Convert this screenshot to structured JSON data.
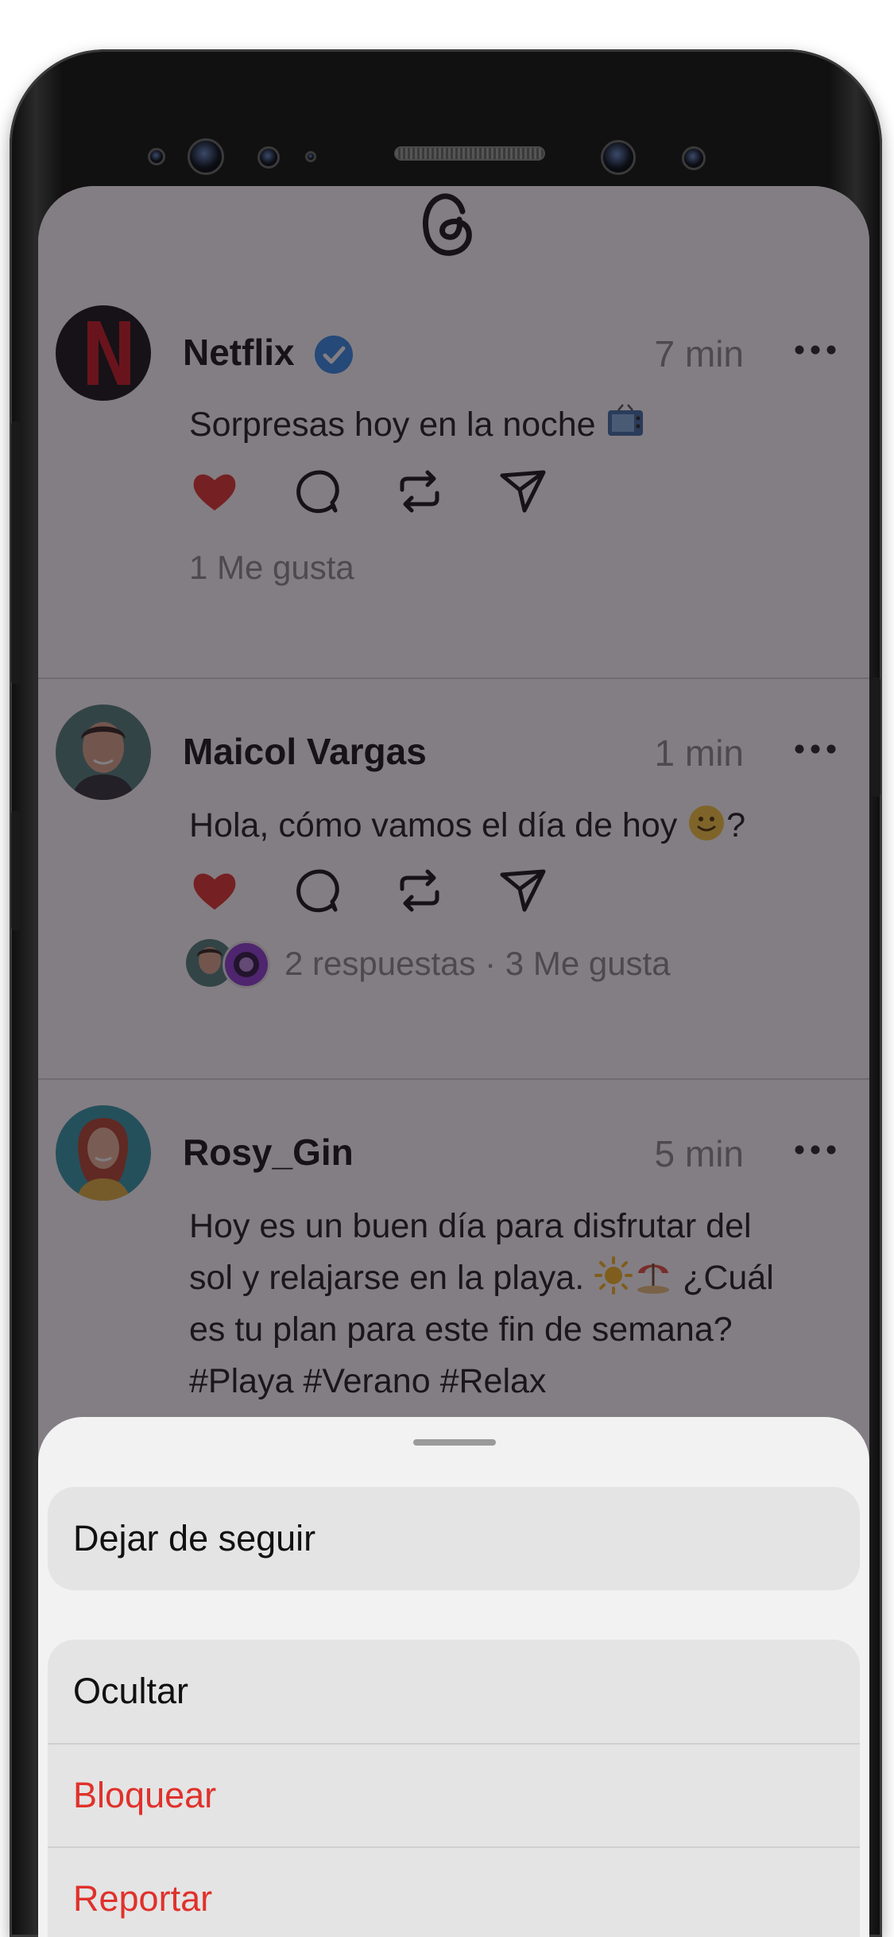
{
  "app": "Threads",
  "posts": [
    {
      "username": "Netflix",
      "verified": true,
      "time": "7 min",
      "text": "Sorpresas hoy en la noche",
      "text_emoji": "tv",
      "liked": true,
      "stats": "1 Me gusta"
    },
    {
      "username": "Maicol Vargas",
      "verified": false,
      "time": "1 min",
      "text_before": "Hola, cómo vamos el día de hoy",
      "text_emoji": "slightly-smiling-face",
      "text_after": "?",
      "liked": true,
      "stats": "2 respuestas · 3 Me gusta"
    },
    {
      "username": "Rosy_Gin",
      "verified": false,
      "time": "5 min",
      "text_line1": "Hoy es un buen día para disfrutar del",
      "text_line2_before": "sol y relajarse en la playa.",
      "text_line2_emojis": [
        "sun",
        "beach-umbrella"
      ],
      "text_line2_after": "¿Cuál",
      "text_line3": "es tu plan para este fin de semana?",
      "text_line4": "#Playa #Verano #Relax"
    }
  ],
  "sheet": {
    "unfollow": "Dejar de seguir",
    "hide": "Ocultar",
    "block": "Bloquear",
    "report": "Reportar"
  },
  "colors": {
    "like": "#e0312b",
    "verified": "#2f8ae6",
    "danger": "#e0312b"
  }
}
